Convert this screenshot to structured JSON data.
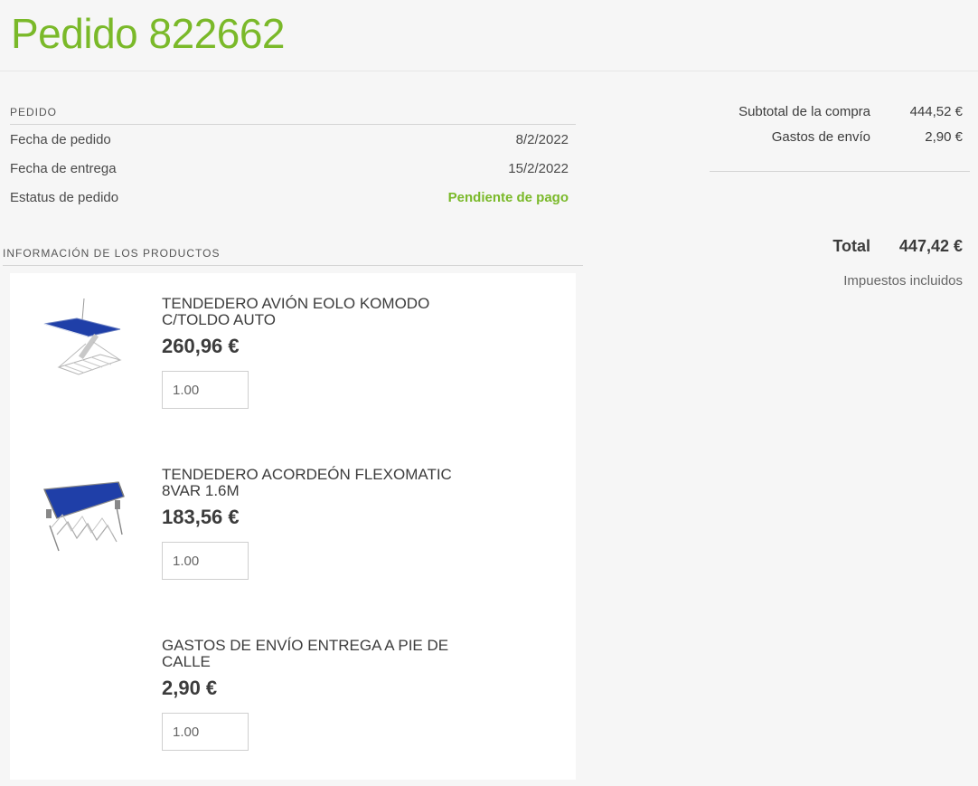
{
  "header": {
    "title": "Pedido 822662"
  },
  "order": {
    "section_label": "PEDIDO",
    "rows": [
      {
        "label": "Fecha de pedido",
        "value": "8/2/2022"
      },
      {
        "label": "Fecha de entrega",
        "value": "15/2/2022"
      },
      {
        "label": "Estatus de pedido",
        "value": "Pendiente de pago"
      }
    ]
  },
  "products": {
    "section_label": "INFORMACIÓN DE LOS PRODUCTOS",
    "items": [
      {
        "name": "TENDEDERO AVIÓN EOLO KOMODO C/TOLDO AUTO",
        "price": "260,96 €",
        "quantity": "1.00",
        "image": "airplane-clothes-airer-awning"
      },
      {
        "name": "TENDEDERO ACORDEÓN FLEXOMATIC 8VAR 1.6M",
        "price": "183,56 €",
        "quantity": "1.00",
        "image": "accordion-clothes-airer"
      },
      {
        "name": "GASTOS DE ENVÍO ENTREGA A PIE DE CALLE",
        "price": "2,90 €",
        "quantity": "1.00",
        "image": ""
      }
    ]
  },
  "summary": {
    "subtotal_label": "Subtotal de la compra",
    "subtotal_value": "444,52 €",
    "shipping_label": "Gastos de envío",
    "shipping_value": "2,90 €",
    "total_label": "Total",
    "total_value": "447,42 €",
    "tax_note": "Impuestos incluidos"
  },
  "colors": {
    "accent_green": "#7ab929",
    "product_blue": "#1f3fa8",
    "background": "#f6f6f6",
    "panel": "#ffffff"
  }
}
